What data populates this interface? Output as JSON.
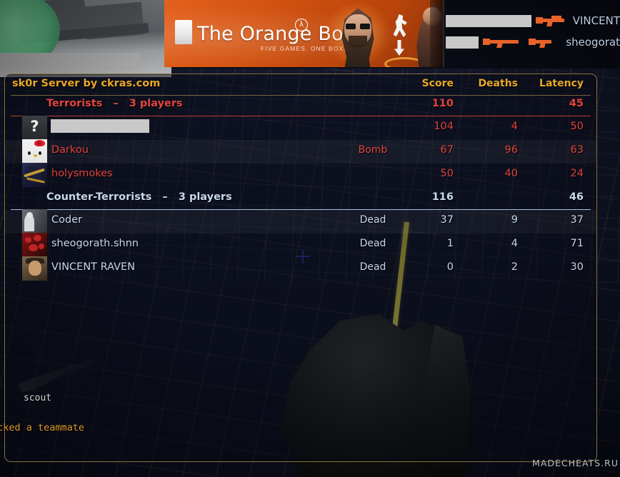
{
  "banner": {
    "title": "The Orange Box",
    "subtitle": "FIVE GAMES. ONE BOX.",
    "lambda": "λ"
  },
  "killfeed": {
    "rows": [
      {
        "victim": "VINCENT",
        "weapon_icon": "sniper-rifle-icon",
        "censored": true
      },
      {
        "victim": "sheogorat",
        "weapon_icon": "smg-icon",
        "censored": true
      }
    ]
  },
  "scoreboard": {
    "title": "sk0r Server by ckras.com",
    "columns": {
      "score": "Score",
      "deaths": "Deaths",
      "latency": "Latency"
    },
    "teams": [
      {
        "name": "Terrorists",
        "dash": "–",
        "players_label": "3 players",
        "score": "110",
        "latency": "45",
        "color": "#e2453f",
        "players": [
          {
            "name": "",
            "censored": true,
            "avatar": "unknown-avatar",
            "status": "",
            "score": "104",
            "deaths": "4",
            "latency": "50",
            "highlight": false
          },
          {
            "name": "Darkou",
            "censored": false,
            "avatar": "hello-kitty-avatar",
            "status": "Bomb",
            "score": "67",
            "deaths": "96",
            "latency": "63",
            "highlight": true
          },
          {
            "name": "holysmokes",
            "censored": false,
            "avatar": "anime-avatar",
            "status": "",
            "score": "50",
            "deaths": "40",
            "latency": "24",
            "highlight": false
          }
        ]
      },
      {
        "name": "Counter-Terrorists",
        "dash": "–",
        "players_label": "3 players",
        "score": "116",
        "latency": "46",
        "color": "#c7d8ec",
        "players": [
          {
            "name": "Coder",
            "censored": false,
            "avatar": "coder-avatar",
            "status": "Dead",
            "score": "37",
            "deaths": "9",
            "latency": "37",
            "highlight": true
          },
          {
            "name": "sheogorath.shnn",
            "censored": false,
            "avatar": "red-avatar",
            "status": "Dead",
            "score": "1",
            "deaths": "4",
            "latency": "71",
            "highlight": false
          },
          {
            "name": "VINCENT RAVEN",
            "censored": false,
            "avatar": "face-avatar",
            "status": "Dead",
            "score": "0",
            "deaths": "2",
            "latency": "30",
            "highlight": false
          }
        ]
      }
    ]
  },
  "hud": {
    "weapon": "scout",
    "chat_message": "acked a teammate",
    "watermark": "MADECHEATS.RU"
  }
}
